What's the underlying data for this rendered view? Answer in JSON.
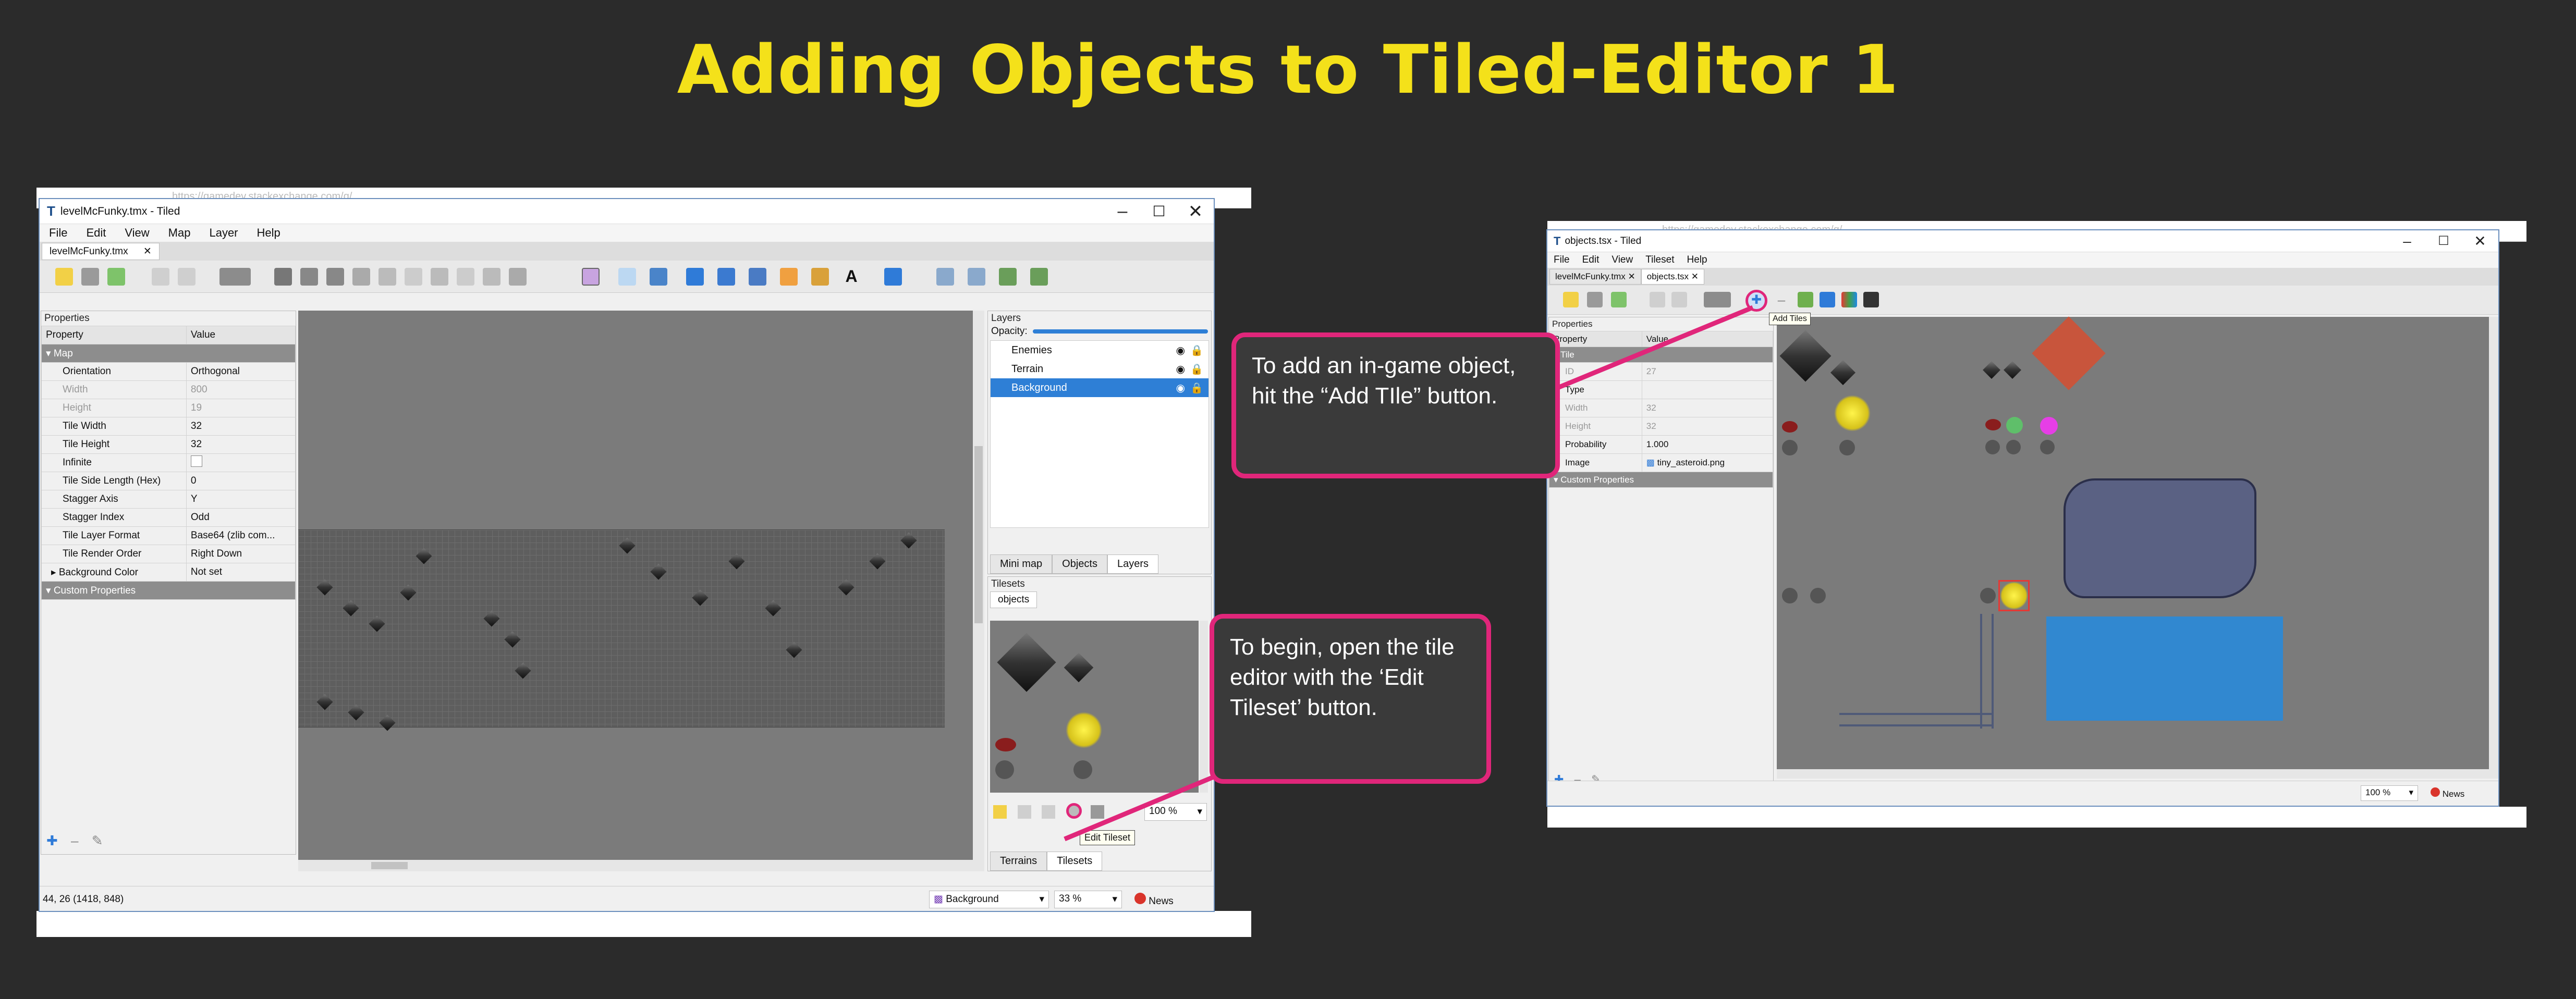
{
  "title": "Adding Objects to Tiled-Editor 1",
  "left_window": {
    "behind_url": "https://gamedev.stackexchange.com/q/...",
    "title": "levelMcFunky.tmx - Tiled",
    "menu": [
      "File",
      "Edit",
      "View",
      "Map",
      "Layer",
      "Help"
    ],
    "doc_tab": "levelMcFunky.tmx",
    "properties_title": "Properties",
    "prop_headers": [
      "Property",
      "Value"
    ],
    "section_map": "Map",
    "rows": [
      {
        "k": "Orientation",
        "v": "Orthogonal"
      },
      {
        "k": "Width",
        "v": "800"
      },
      {
        "k": "Height",
        "v": "19"
      },
      {
        "k": "Tile Width",
        "v": "32"
      },
      {
        "k": "Tile Height",
        "v": "32"
      },
      {
        "k": "Infinite",
        "v": ""
      },
      {
        "k": "Tile Side Length (Hex)",
        "v": "0"
      },
      {
        "k": "Stagger Axis",
        "v": "Y"
      },
      {
        "k": "Stagger Index",
        "v": "Odd"
      },
      {
        "k": "Tile Layer Format",
        "v": "Base64 (zlib com..."
      },
      {
        "k": "Tile Render Order",
        "v": "Right Down"
      },
      {
        "k": "Background Color",
        "v": "Not set"
      }
    ],
    "custom_props": "Custom Properties",
    "layers_title": "Layers",
    "opacity_label": "Opacity:",
    "layers": [
      "Enemies",
      "Terrain",
      "Background"
    ],
    "layer_tabs": [
      "Mini map",
      "Objects",
      "Layers"
    ],
    "tilesets_title": "Tilesets",
    "tileset_tab": "objects",
    "tileset_zoom": "100 %",
    "tooltip": "Edit Tileset",
    "bottom_tabs": [
      "Terrains",
      "Tilesets"
    ],
    "coords": "44, 26 (1418, 848)",
    "status_layer": "Background",
    "zoom": "33 %",
    "news": "News"
  },
  "right_window": {
    "behind_url": "https://gamedev.stackexchange.com/q/...",
    "title": "objects.tsx - Tiled",
    "menu": [
      "File",
      "Edit",
      "View",
      "Tileset",
      "Help"
    ],
    "doc_tabs": [
      "levelMcFunky.tmx",
      "objects.tsx"
    ],
    "tooltip": "Add Tiles",
    "properties_title": "Properties",
    "prop_headers": [
      "Property",
      "Value"
    ],
    "section_tile": "Tile",
    "rows": [
      {
        "k": "ID",
        "v": "27"
      },
      {
        "k": "Type",
        "v": ""
      },
      {
        "k": "Width",
        "v": "32"
      },
      {
        "k": "Height",
        "v": "32"
      },
      {
        "k": "Probability",
        "v": "1.000"
      },
      {
        "k": "Image",
        "v": "tiny_asteroid.png"
      }
    ],
    "custom_props": "Custom Properties",
    "zoom": "100 %",
    "news": "News"
  },
  "callouts": {
    "add_tile": "To add an in-game object, hit the “Add TIle” button.",
    "edit_tileset": "To begin, open the tile editor with the ‘Edit Tileset’ button."
  },
  "colors": {
    "accent": "#e0267a",
    "title": "#f4e11a",
    "background": "#2b2b2b",
    "selection": "#2e7fd6"
  }
}
